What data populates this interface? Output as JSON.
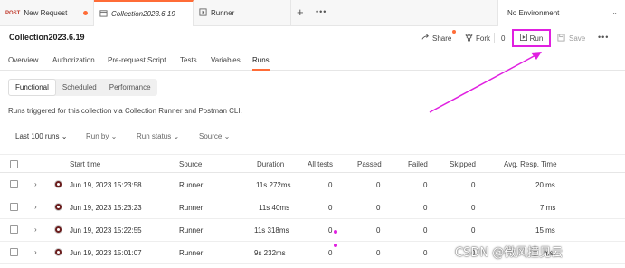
{
  "tabs": [
    {
      "method": "POST",
      "label": "New Request",
      "unsaved": true
    },
    {
      "label": "Collection2023.6.19",
      "active": true
    },
    {
      "label": "Runner"
    }
  ],
  "environment": {
    "label": "No Environment"
  },
  "header": {
    "title": "Collection2023.6.19",
    "share_label": "Share",
    "fork_label": "Fork",
    "fork_count": "0",
    "run_label": "Run",
    "save_label": "Save"
  },
  "subtabs": [
    "Overview",
    "Authorization",
    "Pre-request Script",
    "Tests",
    "Variables",
    "Runs"
  ],
  "segments": [
    "Functional",
    "Scheduled",
    "Performance"
  ],
  "description": "Runs triggered for this collection via Collection Runner and Postman CLI.",
  "filters": [
    "Last 100 runs",
    "Run by",
    "Run status",
    "Source"
  ],
  "table": {
    "columns": [
      "Start time",
      "Source",
      "Duration",
      "All tests",
      "Passed",
      "Failed",
      "Skipped",
      "Avg. Resp. Time"
    ],
    "rows": [
      {
        "start": "Jun 19, 2023 15:23:58",
        "source": "Runner",
        "duration": "11s 272ms",
        "all": "0",
        "passed": "0",
        "failed": "0",
        "skipped": "0",
        "avg": "20 ms"
      },
      {
        "start": "Jun 19, 2023 15:23:23",
        "source": "Runner",
        "duration": "11s 40ms",
        "all": "0",
        "passed": "0",
        "failed": "0",
        "skipped": "0",
        "avg": "7 ms"
      },
      {
        "start": "Jun 19, 2023 15:22:55",
        "source": "Runner",
        "duration": "11s 318ms",
        "all": "0",
        "passed": "0",
        "failed": "0",
        "skipped": "0",
        "avg": "15 ms"
      },
      {
        "start": "Jun 19, 2023 15:01:07",
        "source": "Runner",
        "duration": "9s 232ms",
        "all": "0",
        "passed": "0",
        "failed": "0",
        "skipped": "0",
        "avg": "ms"
      }
    ]
  },
  "watermark": "CSDN @微风撞见云",
  "colors": {
    "accent": "#ff6c37",
    "annotation": "#e020e0"
  }
}
